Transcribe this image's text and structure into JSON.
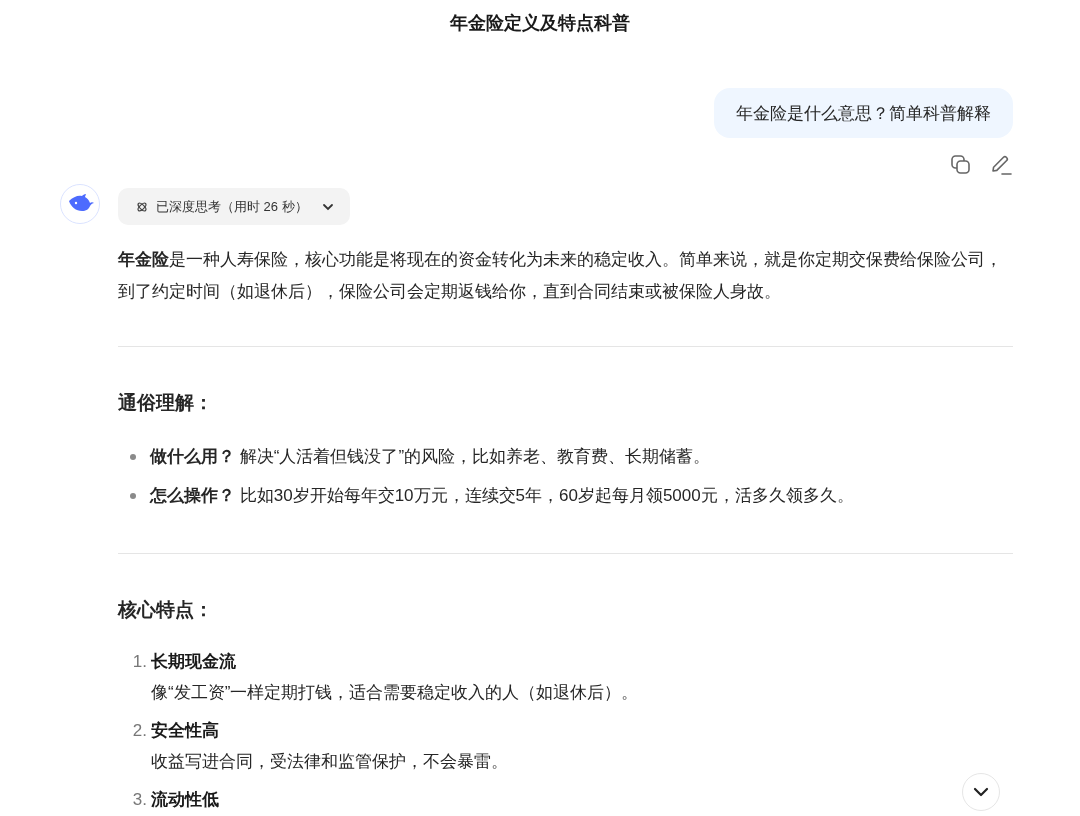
{
  "title": "年金险定义及特点科普",
  "user_message": {
    "text": "年金险是什么意思？简单科普解释"
  },
  "thinking": {
    "label": "已深度思考（用时 26 秒）",
    "expanded": false
  },
  "intro": "**年金险**是一种人寿保险，核心功能是将现在的资金转化为未来的稳定收入。简单来说，就是你定期交保费给保险公司，到了约定时间（如退休后），保险公司会定期返钱给你，直到合同结束或被保险人身故。",
  "sections": [
    {
      "heading": "通俗理解：",
      "kind": "bullets",
      "items": [
        {
          "text": "**做什么用？** 解决“人活着但钱没了”的风险，比如养老、教育费、长期储蓄。"
        },
        {
          "text": "**怎么操作？** 比如30岁开始每年交10万元，连续交5年，60岁起每月领5000元，活多久领多久。"
        }
      ]
    },
    {
      "heading": "核心特点：",
      "kind": "numbered",
      "items": [
        {
          "marker": "1.",
          "title": "长期现金流",
          "text": "像“发工资”一样定期打钱，适合需要稳定收入的人（如退休后）。"
        },
        {
          "marker": "2.",
          "title": "安全性高",
          "text": "收益写进合同，受法律和监管保护，不会暴雷。"
        },
        {
          "marker": "3.",
          "title": "流动性低"
        }
      ]
    }
  ]
}
